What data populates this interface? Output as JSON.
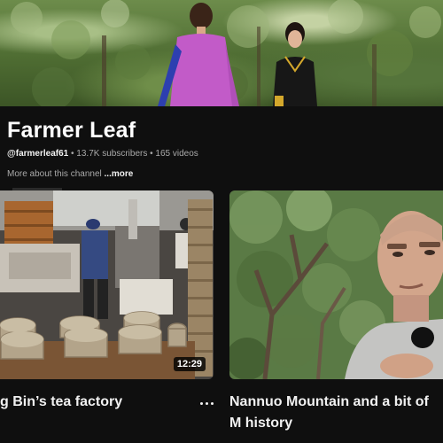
{
  "channel": {
    "name": "Farmer Leaf",
    "handle": "@farmerleaf61",
    "separator": " • ",
    "subscribers": "13.7K subscribers",
    "videos": "165 videos",
    "about_text": "More about this channel",
    "more_label": "...more"
  },
  "videos": [
    {
      "title": "g Bin’s tea factory",
      "duration": "12:29",
      "menu_icon": "more-vert-icon"
    },
    {
      "title": "Nannuo Mountain and a bit of M history",
      "duration": ""
    }
  ],
  "colors": {
    "background": "#0f0f0f",
    "text_primary": "#f1f1f1",
    "text_secondary": "#aaaaaa",
    "dress_pink": "#c25bc8"
  }
}
